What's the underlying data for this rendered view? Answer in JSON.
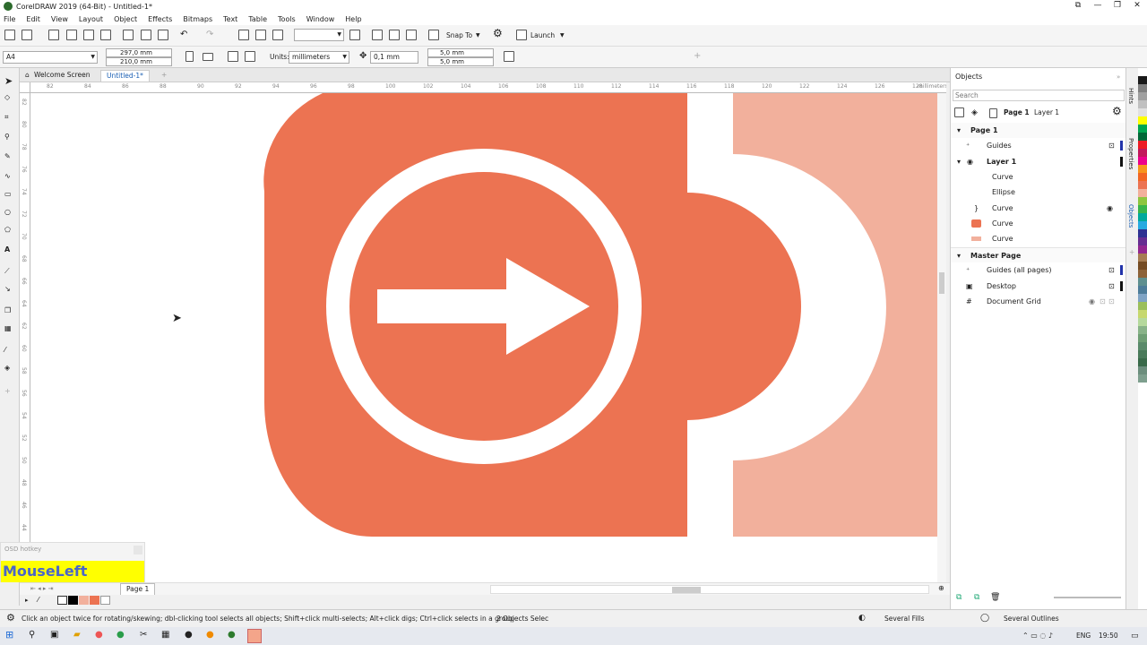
{
  "window": {
    "title": "CorelDRAW 2019 (64-Bit) - Untitled-1*"
  },
  "menu": [
    "File",
    "Edit",
    "View",
    "Layout",
    "Object",
    "Effects",
    "Bitmaps",
    "Text",
    "Table",
    "Tools",
    "Window",
    "Help"
  ],
  "standard_toolbar": {
    "snap_to_label": "Snap To",
    "launch_label": "Launch",
    "zoom_value": ""
  },
  "property_bar": {
    "page_size": "A4",
    "width": "297,0 mm",
    "height": "210,0 mm",
    "units_label": "Units:",
    "units_value": "millimeters",
    "nudge": "0,1 mm",
    "dup_x": "5,0 mm",
    "dup_y": "5,0 mm"
  },
  "doc_tabs": [
    {
      "label": "Welcome Screen",
      "active": false
    },
    {
      "label": "Untitled-1*",
      "active": true
    }
  ],
  "ruler": {
    "h_labels": [
      "82",
      "84",
      "86",
      "88",
      "90",
      "92",
      "94",
      "96",
      "98",
      "100",
      "102",
      "104",
      "106",
      "108",
      "110",
      "112",
      "114",
      "116",
      "118",
      "120",
      "122",
      "124",
      "126",
      "128"
    ],
    "h_units": "millimeters",
    "v_labels": [
      "82",
      "80",
      "78",
      "76",
      "74",
      "72",
      "70",
      "68",
      "66",
      "64",
      "62",
      "60",
      "58",
      "56",
      "54",
      "52",
      "50",
      "48",
      "46",
      "44",
      "42",
      "40"
    ]
  },
  "page_nav": {
    "page_label": "Page 1"
  },
  "objects_panel": {
    "title": "Objects",
    "search_placeholder": "Search",
    "toolbar_page": "Page 1",
    "toolbar_layer": "Layer 1",
    "rows": [
      {
        "label": "Page 1",
        "level": 0,
        "bold": true,
        "expand": "▼"
      },
      {
        "label": "Guides",
        "level": 1,
        "bold": false,
        "expand": ""
      },
      {
        "label": "Layer 1",
        "level": 1,
        "bold": true,
        "expand": "▼"
      },
      {
        "label": "Curve",
        "level": 2,
        "bold": false,
        "expand": ""
      },
      {
        "label": "Ellipse",
        "level": 2,
        "bold": false,
        "expand": ""
      },
      {
        "label": "Curve",
        "level": 2,
        "bold": false,
        "expand": ""
      },
      {
        "label": "Curve",
        "level": 2,
        "bold": false,
        "expand": ""
      },
      {
        "label": "Curve",
        "level": 2,
        "bold": false,
        "expand": ""
      },
      {
        "label": "Master Page",
        "level": 0,
        "bold": true,
        "expand": "▼"
      },
      {
        "label": "Guides (all pages)",
        "level": 1,
        "bold": false,
        "expand": ""
      },
      {
        "label": "Desktop",
        "level": 1,
        "bold": false,
        "expand": ""
      },
      {
        "label": "Document Grid",
        "level": 1,
        "bold": false,
        "expand": ""
      }
    ]
  },
  "docker_tabs": [
    "Hints",
    "Properties",
    "Objects"
  ],
  "status": {
    "hint": "Click an object twice for rotating/skewing; dbl-clicking tool selects all objects; Shift+click multi-selects; Alt+click digs; Ctrl+click selects in a group",
    "selection": "2 Objects Selec",
    "fill": "Several Fills",
    "outline": "Several Outlines"
  },
  "taskbar": {
    "lang": "ENG",
    "time": "19:50"
  },
  "osd": {
    "header": "OSD hotkey",
    "key": "MouseLeft"
  },
  "colors": {
    "coral": "#ec7352",
    "light_coral": "#f2b09c",
    "white": "#ffffff"
  },
  "palette": [
    "#ffffff",
    "#1a1a1a",
    "#808080",
    "#a0a0a0",
    "#c0c0c0",
    "#e0e0e0",
    "#ffff00",
    "#00a651",
    "#006837",
    "#ed1c24",
    "#c2185b",
    "#ec008c",
    "#f7941d",
    "#f26522",
    "#ec7352",
    "#f2b09c",
    "#8dc63f",
    "#39b54a",
    "#00a99d",
    "#27aae1",
    "#2e3192",
    "#662d91",
    "#92278f",
    "#a67c52",
    "#754c24",
    "#8c6239",
    "#5e8f8f",
    "#4d7c99",
    "#7fa3c4",
    "#9bbf5b",
    "#c6d86e",
    "#b5d99c",
    "#88b388",
    "#6e9e74",
    "#5a8a6a",
    "#4a7a5a",
    "#3a6a4a",
    "#6c8e7d",
    "#7e9f8e"
  ]
}
